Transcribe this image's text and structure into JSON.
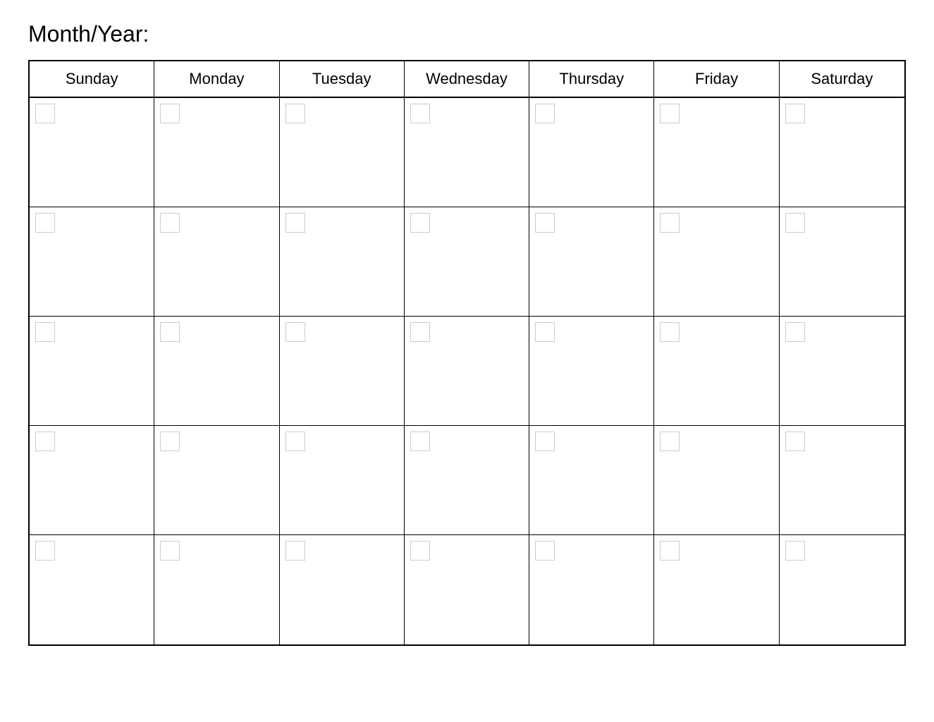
{
  "header": {
    "title": "Month/Year:"
  },
  "calendar": {
    "days": [
      "Sunday",
      "Monday",
      "Tuesday",
      "Wednesday",
      "Thursday",
      "Friday",
      "Saturday"
    ],
    "rows": 5
  }
}
